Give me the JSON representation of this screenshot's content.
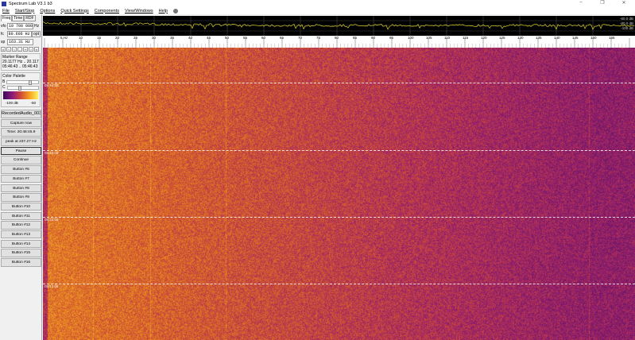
{
  "window": {
    "title": "Spectrum Lab V3.1 b3",
    "minimize": "–",
    "maximize": "❐",
    "close": "✕"
  },
  "menu": [
    "File",
    "Start/Stop",
    "Options",
    "Quick Settings",
    "Components",
    "View/Windows",
    "Help"
  ],
  "left": {
    "tabs": [
      "Freq",
      "Time",
      "RDF"
    ],
    "vfo": {
      "label": "vfo",
      "value": "10 700 000",
      "unit": "Hz"
    },
    "fc": {
      "label": "fc",
      "value": "80.606 Hz",
      "btn": "opt"
    },
    "sp": {
      "label": "sp",
      "value": "163.31 Hz"
    },
    "arrows": [
      "«",
      "‹",
      "‹",
      "-",
      "+",
      "›",
      "»"
    ],
    "marker": {
      "title": "Marker Range",
      "freq": "20.1177 Hz .. 20.1177 H.",
      "time": "05:46:43 .. 05:46:43"
    },
    "palette": {
      "title": "Color Palette",
      "b": "B",
      "c": "C",
      "min": "-100 dB",
      "max": "-50",
      "brightness": 0.7,
      "contrast": 0.35
    },
    "buttons": [
      "RecordedAudio_003.",
      "Capture now",
      "Time: 20:48:45.9",
      "peak at 237.27 Hz",
      "Pause",
      "Continue",
      "Button #6",
      "Button #7",
      "Button #8",
      "Button #9",
      "Button #10",
      "Button #11",
      "Button #12",
      "Button #13",
      "Button #14",
      "Button #15",
      "Button #16"
    ]
  },
  "spectrum": {
    "db_labels": [
      "-60.0 dB",
      "-80.0 dB",
      "-100 dB"
    ]
  },
  "ruler": {
    "labels": [
      "5 Hz",
      "10",
      "15",
      "20",
      "25",
      "30",
      "35",
      "40",
      "45",
      "50",
      "55",
      "60",
      "65",
      "70",
      "75",
      "80",
      "85",
      "90",
      "95",
      "100",
      "105",
      "110",
      "115",
      "120",
      "125",
      "130",
      "135",
      "140",
      "145",
      "150",
      "155"
    ]
  },
  "waterfall": {
    "time_labels": [
      "05:43:08",
      "05:33:08",
      "05:23:08",
      "05:13:08"
    ]
  }
}
